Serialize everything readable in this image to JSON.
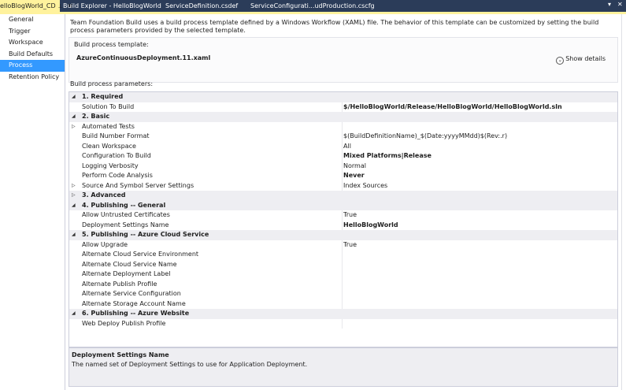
{
  "tabs": [
    {
      "label": "elloBlogWorld_CD",
      "active": true
    },
    {
      "label": "Build Explorer - HelloBlogWorld"
    },
    {
      "label": "ServiceDefinition.csdef"
    },
    {
      "label": "ServiceConfigurati...udProduction.cscfg"
    }
  ],
  "sidebar": {
    "items": [
      "General",
      "Trigger",
      "Workspace",
      "Build Defaults",
      "Process",
      "Retention Policy"
    ],
    "selected": "Process"
  },
  "main": {
    "description": "Team Foundation Build uses a build process template defined by a Windows Workflow (XAML) file. The behavior of this template can be customized by setting the build process parameters provided by the selected template.",
    "template_label": "Build process template:",
    "template_name": "AzureContinuousDeployment.11.xaml",
    "show_details": "Show details",
    "params_label": "Build process parameters:"
  },
  "grid": {
    "rows": [
      {
        "type": "cat",
        "name": "1. Required",
        "expander": "collapse"
      },
      {
        "type": "prop",
        "name": "Solution To Build",
        "value": "$/HelloBlogWorld/Release/HelloBlogWorld/HelloBlogWorld.sln",
        "bold": true
      },
      {
        "type": "cat",
        "name": "2. Basic",
        "expander": "collapse"
      },
      {
        "type": "prop",
        "name": "Automated Tests",
        "value": "",
        "expander": "expand"
      },
      {
        "type": "prop",
        "name": "Build Number Format",
        "value": "$(BuildDefinitionName)_$(Date:yyyyMMdd)$(Rev:.r)"
      },
      {
        "type": "prop",
        "name": "Clean Workspace",
        "value": "All"
      },
      {
        "type": "prop",
        "name": "Configuration To Build",
        "value": "Mixed Platforms|Release",
        "bold": true
      },
      {
        "type": "prop",
        "name": "Logging Verbosity",
        "value": "Normal"
      },
      {
        "type": "prop",
        "name": "Perform Code Analysis",
        "value": "Never",
        "bold": true
      },
      {
        "type": "prop",
        "name": "Source And Symbol Server Settings",
        "value": "Index Sources",
        "expander": "expand"
      },
      {
        "type": "cat",
        "name": "3. Advanced",
        "expander": "expand"
      },
      {
        "type": "cat",
        "name": "4. Publishing -- General",
        "expander": "collapse"
      },
      {
        "type": "prop",
        "name": "Allow Untrusted Certificates",
        "value": "True"
      },
      {
        "type": "prop",
        "name": "Deployment Settings Name",
        "value": "HelloBlogWorld",
        "bold": true
      },
      {
        "type": "cat",
        "name": "5. Publishing -- Azure Cloud Service",
        "expander": "collapse"
      },
      {
        "type": "prop",
        "name": "Allow Upgrade",
        "value": "True"
      },
      {
        "type": "prop",
        "name": "Alternate Cloud Service Environment",
        "value": ""
      },
      {
        "type": "prop",
        "name": "Alternate Cloud Service Name",
        "value": ""
      },
      {
        "type": "prop",
        "name": "Alternate Deployment Label",
        "value": ""
      },
      {
        "type": "prop",
        "name": "Alternate Publish Profile",
        "value": ""
      },
      {
        "type": "prop",
        "name": "Alternate Service Configuration",
        "value": ""
      },
      {
        "type": "prop",
        "name": "Alternate Storage Account Name",
        "value": ""
      },
      {
        "type": "cat",
        "name": "6. Publishing -- Azure Website",
        "expander": "collapse"
      },
      {
        "type": "prop",
        "name": "Web Deploy Publish Profile",
        "value": ""
      }
    ]
  },
  "help": {
    "title": "Deployment Settings Name",
    "text": "The named set of Deployment Settings to use for Application Deployment."
  },
  "colors": {
    "tabbar": "#2b3c59",
    "active_tab": "#fff29d",
    "selection": "#3399ff",
    "category_bg": "#eeeef2"
  },
  "icons": {
    "tab_close": "close-icon",
    "tab_pin": "pin-icon",
    "show_details": "chevron-down-circle-icon",
    "collapse": "triangle-down-icon",
    "expand": "triangle-right-icon"
  }
}
